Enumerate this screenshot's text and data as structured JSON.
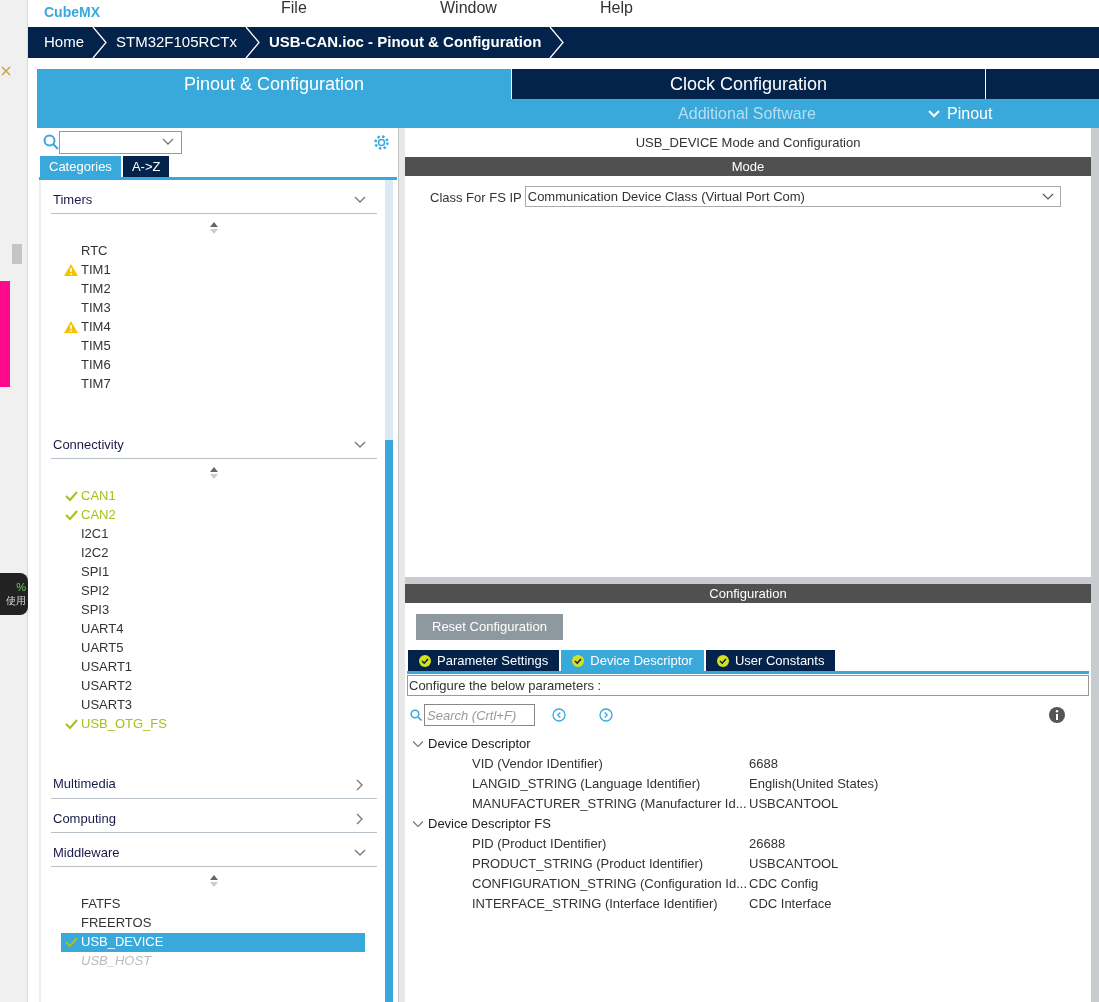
{
  "side_strip": {
    "badge_percent": "%",
    "badge_text": "使用"
  },
  "header": {
    "logo": "CubeMX",
    "menu": [
      "File",
      "Window",
      "Help"
    ]
  },
  "breadcrumbs": [
    {
      "label": "Home",
      "current": false
    },
    {
      "label": "STM32F105RCTx",
      "current": false
    },
    {
      "label": "USB-CAN.ioc - Pinout & Configuration",
      "current": true
    }
  ],
  "main_tabs": [
    {
      "label": "Pinout & Configuration",
      "selected": true
    },
    {
      "label": "Clock Configuration",
      "selected": false
    }
  ],
  "subbar": {
    "additional": "Additional Software",
    "pinout": "Pinout"
  },
  "left": {
    "view_tabs": [
      {
        "label": "Categories",
        "selected": true
      },
      {
        "label": "A->Z",
        "selected": false
      }
    ],
    "categories": [
      {
        "label": "Timers",
        "expanded": true,
        "items": [
          {
            "label": "RTC",
            "kind": "none",
            "selected": false
          },
          {
            "label": "TIM1",
            "kind": "warning",
            "selected": false
          },
          {
            "label": "TIM2",
            "kind": "none",
            "selected": false
          },
          {
            "label": "TIM3",
            "kind": "none",
            "selected": false
          },
          {
            "label": "TIM4",
            "kind": "warning",
            "selected": false
          },
          {
            "label": "TIM5",
            "kind": "none",
            "selected": false
          },
          {
            "label": "TIM6",
            "kind": "none",
            "selected": false
          },
          {
            "label": "TIM7",
            "kind": "none",
            "selected": false
          }
        ]
      },
      {
        "label": "Connectivity",
        "expanded": true,
        "items": [
          {
            "label": "CAN1",
            "kind": "enabled",
            "selected": false
          },
          {
            "label": "CAN2",
            "kind": "enabled",
            "selected": false
          },
          {
            "label": "I2C1",
            "kind": "none",
            "selected": false
          },
          {
            "label": "I2C2",
            "kind": "none",
            "selected": false
          },
          {
            "label": "SPI1",
            "kind": "none",
            "selected": false
          },
          {
            "label": "SPI2",
            "kind": "none",
            "selected": false
          },
          {
            "label": "SPI3",
            "kind": "none",
            "selected": false
          },
          {
            "label": "UART4",
            "kind": "none",
            "selected": false
          },
          {
            "label": "UART5",
            "kind": "none",
            "selected": false
          },
          {
            "label": "USART1",
            "kind": "none",
            "selected": false
          },
          {
            "label": "USART2",
            "kind": "none",
            "selected": false
          },
          {
            "label": "USART3",
            "kind": "none",
            "selected": false
          },
          {
            "label": "USB_OTG_FS",
            "kind": "enabled",
            "selected": false
          }
        ]
      },
      {
        "label": "Multimedia",
        "expanded": false
      },
      {
        "label": "Computing",
        "expanded": false
      },
      {
        "label": "Middleware",
        "expanded": true,
        "items": [
          {
            "label": "FATFS",
            "kind": "none",
            "selected": false
          },
          {
            "label": "FREERTOS",
            "kind": "none",
            "selected": false
          },
          {
            "label": "USB_DEVICE",
            "kind": "enabled",
            "selected": true
          },
          {
            "label": "USB_HOST",
            "kind": "disabled",
            "selected": false
          }
        ]
      }
    ]
  },
  "right": {
    "title": "USB_DEVICE Mode and Configuration",
    "mode_header": "Mode",
    "class_label": "Class For FS IP",
    "class_value": "Communication Device Class (Virtual Port Com)",
    "config_header": "Configuration",
    "reset_button": "Reset Configuration",
    "config_tabs": [
      {
        "label": "Parameter Settings",
        "selected": false
      },
      {
        "label": "Device Descriptor",
        "selected": true
      },
      {
        "label": "User Constants",
        "selected": false
      }
    ],
    "hint": "Configure the below parameters :",
    "search_placeholder": "Search (Crtl+F)",
    "groups": [
      {
        "label": "Device Descriptor",
        "expanded": true,
        "params": [
          {
            "name": "VID (Vendor IDentifier)",
            "value": "6688"
          },
          {
            "name": "LANGID_STRING (Language Identifier)",
            "value": "English(United States)"
          },
          {
            "name": "MANUFACTURER_STRING (Manufacturer Id...",
            "value": "USBCANTOOL"
          }
        ]
      },
      {
        "label": "Device Descriptor FS",
        "expanded": true,
        "params": [
          {
            "name": "PID (Product IDentifier)",
            "value": "26688"
          },
          {
            "name": "PRODUCT_STRING (Product Identifier)",
            "value": "USBCANTOOL"
          },
          {
            "name": "CONFIGURATION_STRING (Configuration Id...",
            "value": "CDC Config"
          },
          {
            "name": "INTERFACE_STRING (Interface Identifier)",
            "value": "CDC Interface"
          }
        ]
      }
    ]
  }
}
